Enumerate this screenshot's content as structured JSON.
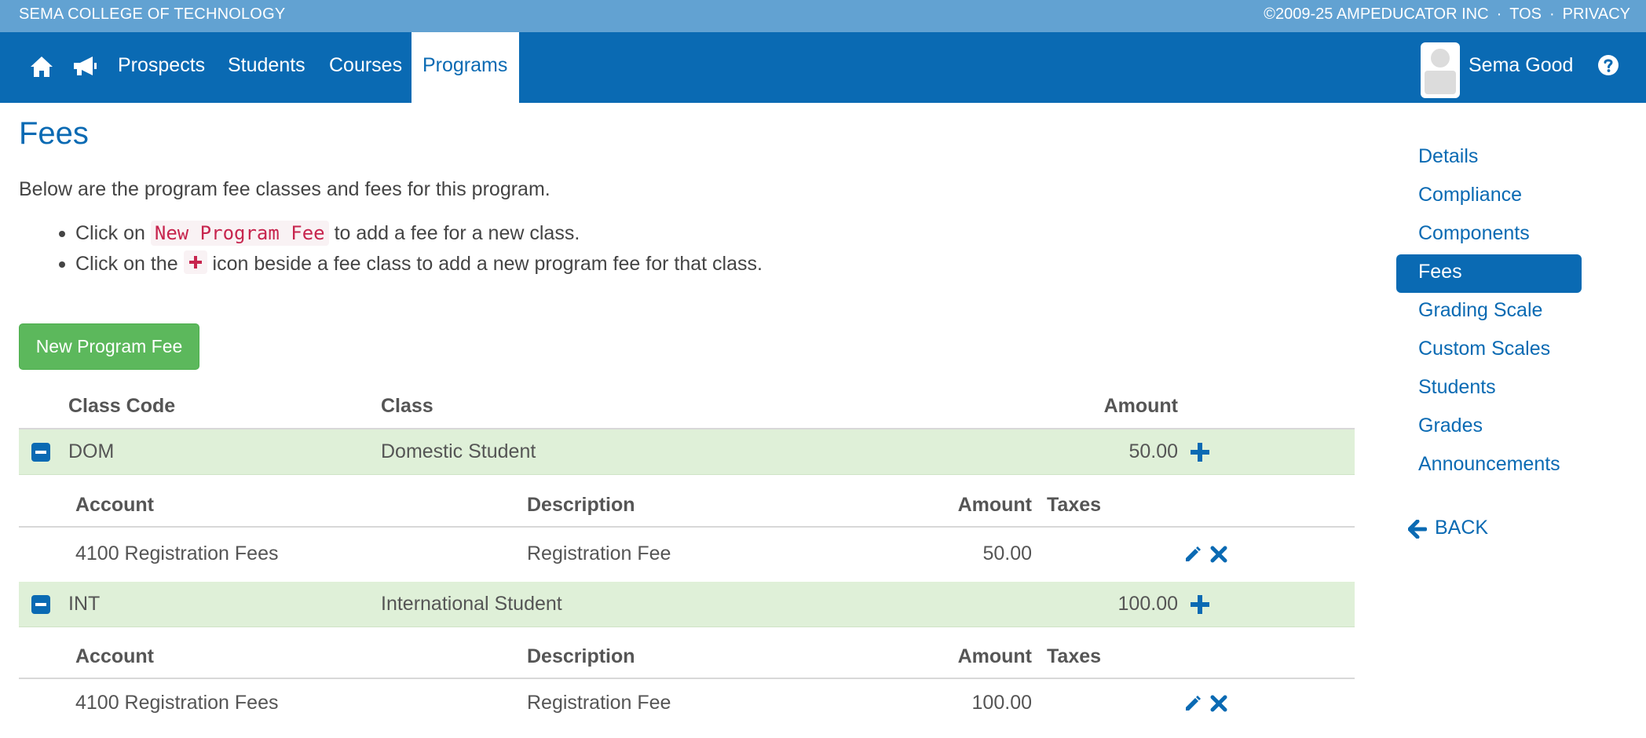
{
  "topbar": {
    "school": "SEMA COLLEGE OF TECHNOLOGY",
    "copyright": "©2009-25 AMPEDUCATOR INC",
    "tos": "TOS",
    "privacy": "PRIVACY",
    "separator": "·"
  },
  "nav": {
    "home_icon": "home-icon",
    "announce_icon": "bullhorn-icon",
    "links": [
      "Prospects",
      "Students",
      "Courses",
      "Programs"
    ],
    "active": "Programs",
    "user_name": "Sema Good",
    "help_icon": "question-circle-icon"
  },
  "page": {
    "title": "Fees",
    "intro": "Below are the program fee classes and fees for this program.",
    "bullet1_pre": "Click on",
    "bullet1_code": "New Program Fee",
    "bullet1_post": "to add a fee for a new class.",
    "bullet2_pre": "Click on the",
    "bullet2_post": "icon beside a fee class to add a new program fee for that class.",
    "new_button": "New Program Fee"
  },
  "table": {
    "headers": {
      "class_code": "Class Code",
      "class": "Class",
      "amount": "Amount"
    },
    "sub_headers": {
      "account": "Account",
      "description": "Description",
      "amount": "Amount",
      "taxes": "Taxes"
    },
    "classes": [
      {
        "code": "DOM",
        "name": "Domestic Student",
        "amount": "50.00",
        "fees": [
          {
            "account": "4100 Registration Fees",
            "description": "Registration Fee",
            "amount": "50.00",
            "taxes": ""
          }
        ]
      },
      {
        "code": "INT",
        "name": "International Student",
        "amount": "100.00",
        "fees": [
          {
            "account": "4100 Registration Fees",
            "description": "Registration Fee",
            "amount": "100.00",
            "taxes": ""
          }
        ]
      }
    ]
  },
  "sidebar": {
    "items": [
      "Details",
      "Compliance",
      "Components",
      "Fees",
      "Grading Scale",
      "Custom Scales",
      "Students",
      "Grades",
      "Announcements"
    ],
    "active": "Fees",
    "back": "BACK"
  },
  "colors": {
    "primary": "#0a6ab3",
    "topbar": "#62a2d2",
    "success": "#5cb85c",
    "row_highlight": "#dff0d8",
    "code_text": "#c7254e"
  }
}
